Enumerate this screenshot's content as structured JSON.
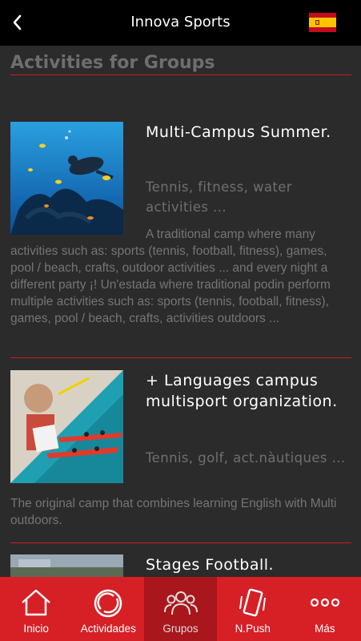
{
  "header": {
    "title": "Innova Sports"
  },
  "section": {
    "title": "Activities for Groups"
  },
  "activities": [
    {
      "title": "Multi-Campus Summer.",
      "subtitle": "Tennis, fitness, water activities ...",
      "description": "A traditional camp where many activities such as: sports (tennis, football, fitness), games, pool / beach, crafts, outdoor activities ... and every night a different party ¡! Un'estada where traditional podin perform multiple activities such as: sports (tennis, football, fitness), games, pool / beach, crafts, activities outdoors ..."
    },
    {
      "title": "+ Languages campus multisport organization.",
      "subtitle": "Tennis, golf, act.nàutiques ...",
      "description": "The original camp that combines learning English with Multi outdoors."
    },
    {
      "title": "Stages Football."
    }
  ],
  "tabbar": {
    "items": [
      {
        "label": "Inicio",
        "icon": "home-icon"
      },
      {
        "label": "Actividades",
        "icon": "activity-ring-icon"
      },
      {
        "label": "Grupos",
        "icon": "group-icon"
      },
      {
        "label": "N.Push",
        "icon": "phone-vibrate-icon"
      },
      {
        "label": "Más",
        "icon": "more-icon"
      }
    ],
    "active_index": 2
  },
  "colors": {
    "accent": "#d71f26",
    "background": "#2b2b2b",
    "topbar": "#000000"
  }
}
